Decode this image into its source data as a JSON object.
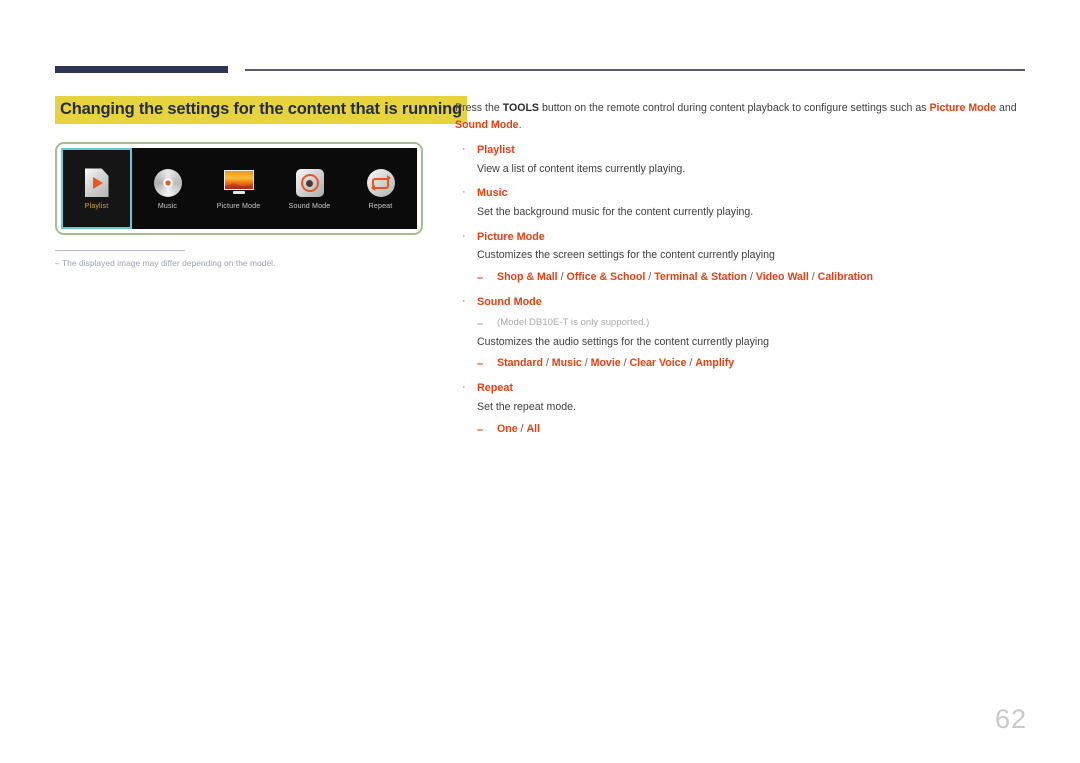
{
  "header": {
    "rule_thick_color": "#2e3653",
    "rule_thin_color": "#545a78"
  },
  "section": {
    "title": "Changing the settings for the content that is running",
    "highlight_color": "#e7d33c",
    "title_color": "#242b45"
  },
  "figure": {
    "frame_color": "#a8bb8e",
    "screen_bg": "#0b0b0b",
    "selection_color": "#66c8d8",
    "selected_label_color": "#d8a63a",
    "menu_items": [
      {
        "label": "Playlist",
        "icon": "playlist-page-play-icon",
        "selected": true
      },
      {
        "label": "Music",
        "icon": "music-cd-icon",
        "selected": false
      },
      {
        "label": "Picture Mode",
        "icon": "monitor-picture-icon",
        "selected": false
      },
      {
        "label": "Sound Mode",
        "icon": "speaker-sound-icon",
        "selected": false
      },
      {
        "label": "Repeat",
        "icon": "repeat-loop-icon",
        "selected": false
      }
    ],
    "note_dash": "–",
    "note_text": "The displayed image may differ depending on the model."
  },
  "content": {
    "intro": {
      "part1": "Press the ",
      "tools": "TOOLS",
      "part2": " button on the remote control during content playback to configure settings such as ",
      "picture_mode": "Picture Mode",
      "part3": " and ",
      "sound_mode": "Sound Mode",
      "part4": "."
    },
    "bullet_marker": "·",
    "dash_marker": "–",
    "items": [
      {
        "title": "Playlist",
        "body": "View a list of content items currently playing.",
        "options": null,
        "grey_note": null
      },
      {
        "title": "Music",
        "body": "Set the background music for the content currently playing.",
        "options": null,
        "grey_note": null
      },
      {
        "title": "Picture Mode",
        "body": "Customizes the screen settings for the content currently playing",
        "options": "Shop & Mall / Office & School / Terminal & Station / Video Wall / Calibration",
        "grey_note": null
      },
      {
        "title": "Sound Mode",
        "body": "Customizes the audio settings for the content currently playing",
        "options": "Standard / Music / Movie / Clear Voice / Amplify",
        "grey_note": "(Model DB10E-T is only supported.)"
      },
      {
        "title": "Repeat",
        "body": "Set the repeat mode.",
        "options": "One / All",
        "grey_note": null
      }
    ],
    "accent_color": "#e04316"
  },
  "footer": {
    "page_number": "62"
  }
}
